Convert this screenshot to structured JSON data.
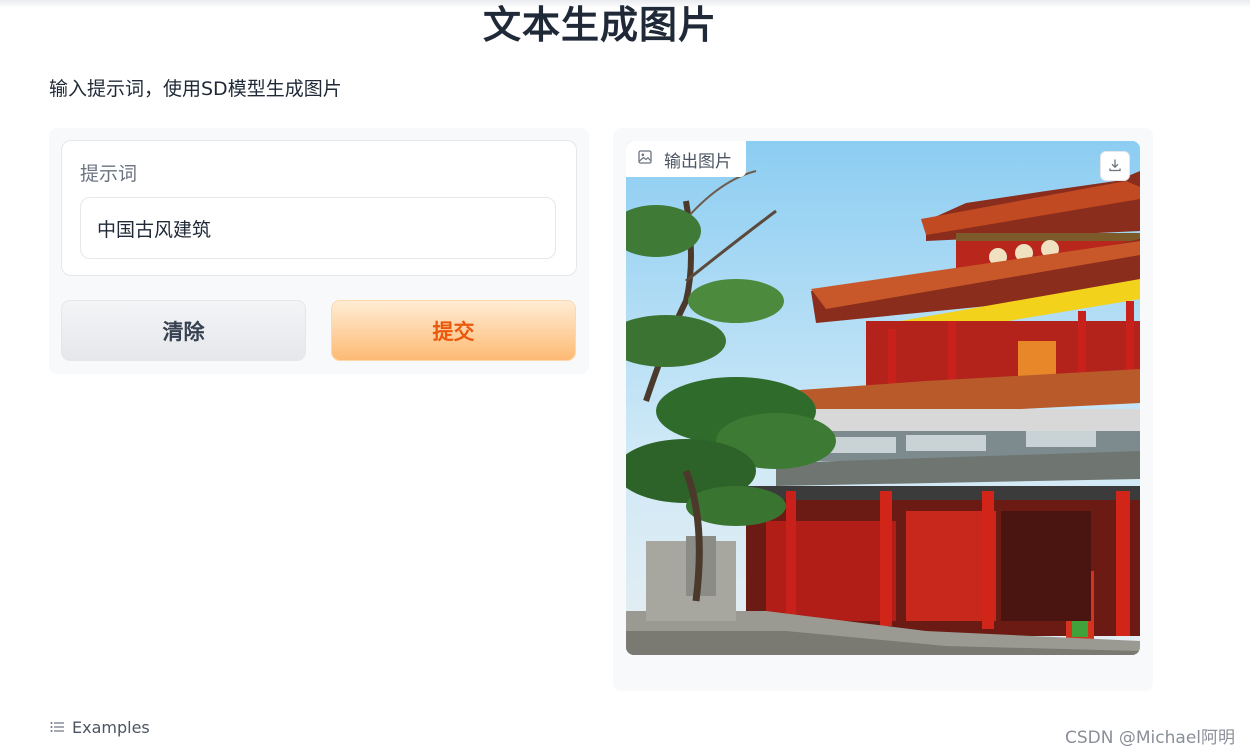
{
  "page": {
    "title": "文本生成图片",
    "description": "输入提示词，使用SD模型生成图片"
  },
  "input_panel": {
    "prompt_label": "提示词",
    "prompt_value": "中国古风建筑",
    "clear_button": "清除",
    "submit_button": "提交"
  },
  "output_panel": {
    "label": "输出图片",
    "label_icon": "image-icon",
    "download_icon": "download-icon",
    "image_subject": "traditional Chinese palace building with red pillars and a pine tree"
  },
  "examples": {
    "label": "Examples",
    "icon": "list-icon"
  },
  "watermark": "CSDN @Michael阿明",
  "colors": {
    "submit_text": "#ea580c",
    "submit_bg": "#fdba74",
    "pillar_red": "#c8201a"
  }
}
